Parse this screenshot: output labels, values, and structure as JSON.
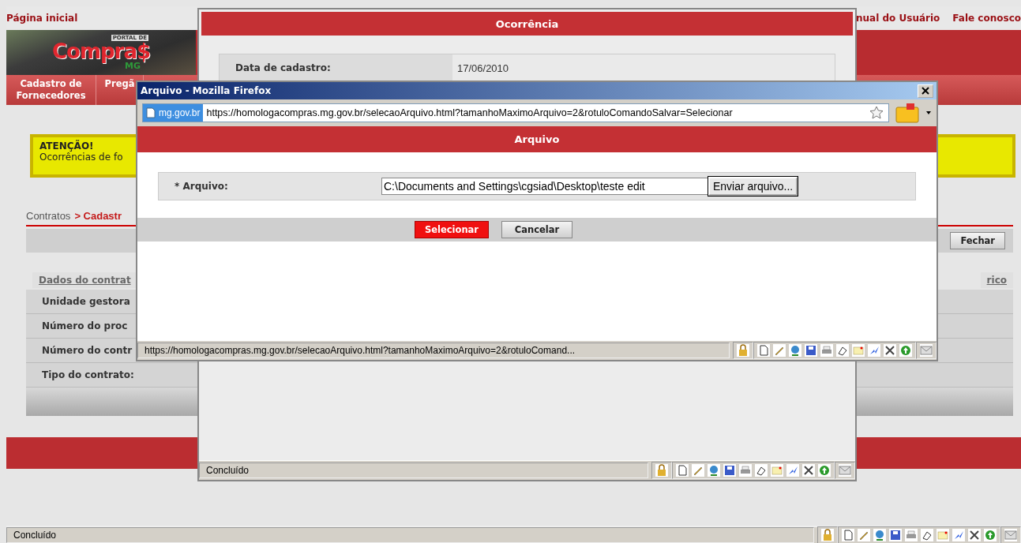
{
  "page": {
    "logo": {
      "tagline": "PORTAL DE",
      "name": "Compra$",
      "region": "MG"
    },
    "top_links": [
      {
        "label": "Página inicial",
        "kind": "home"
      },
      {
        "label": "nual do Usuário",
        "kind": "right"
      },
      {
        "label": "Fale conosco",
        "kind": "right"
      }
    ],
    "menu": [
      {
        "label": "Cadastro de Fornecedores"
      },
      {
        "label": "Pregã"
      }
    ],
    "alert": {
      "title": "ATENÇÃO!",
      "text": "Ocorrências de fo"
    },
    "breadcrumb": {
      "parent": "Contratos",
      "current": "> Cadastr"
    },
    "close_button": "Fechar",
    "tabs": [
      {
        "label": "Dados do contrat"
      },
      {
        "label": "rico"
      }
    ],
    "fields": [
      "Unidade gestora",
      "Número do proc",
      "Número do contr",
      "Tipo do contrato:"
    ],
    "status": "Concluído"
  },
  "occurrence_window": {
    "title": "Ocorrência",
    "fields": [
      {
        "label": "Data de cadastro:",
        "value": "17/06/2010"
      }
    ],
    "status": "Concluído"
  },
  "popup": {
    "title": "Arquivo - Mozilla Firefox",
    "site": "mg.gov.br",
    "url": "https://homologacompras.mg.gov.br/selecaoArquivo.html?tamanhoMaximoArquivo=2&rotuloComandoSalvar=Selecionar",
    "header": "Arquivo",
    "field": {
      "label": "* Arquivo:",
      "value": "C:\\Documents and Settings\\cgsiad\\Desktop\\teste edit",
      "button": "Enviar arquivo..."
    },
    "buttons": [
      {
        "label": "Selecionar",
        "kind": "primary"
      },
      {
        "label": "Cancelar",
        "kind": "secondary"
      }
    ],
    "status": "https://homologacompras.mg.gov.br/selecaoArquivo.html?tamanhoMaximoArquivo=2&rotuloComand..."
  }
}
